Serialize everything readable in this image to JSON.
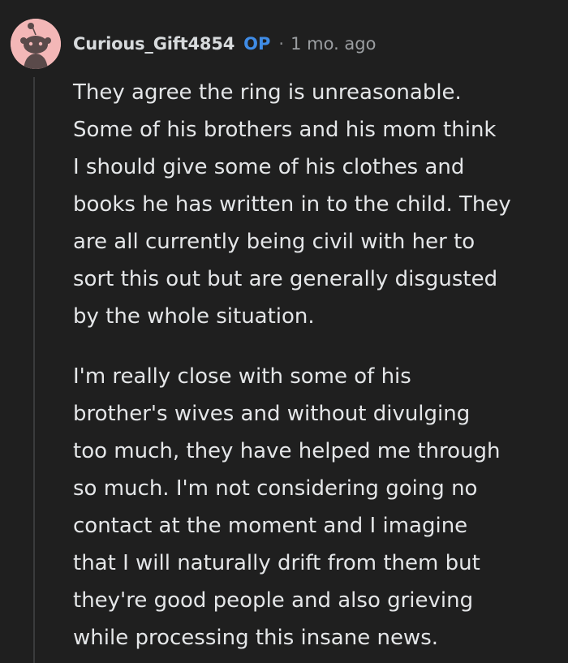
{
  "comment": {
    "username": "Curious_Gift4854",
    "op_badge": "OP",
    "separator": "·",
    "timestamp": "1 mo. ago",
    "avatar_icon": "snoo-avatar-icon",
    "paragraphs": [
      [
        "They agree the ring is unreasonable.",
        "Some of his brothers and his mom think",
        "I should give some of his clothes and",
        "books he has written in to the child. They",
        "are all currently being civil with her to",
        "sort this out but are generally disgusted",
        "by the whole situation."
      ],
      [
        "I'm really close with some of his",
        "brother's wives and without divulging",
        "too much, they have helped me through",
        "so much. I'm not considering going no",
        "contact at the moment and I imagine",
        "that I will naturally drift from them but",
        "they're good people and also grieving",
        "while processing this insane news."
      ]
    ]
  },
  "colors": {
    "background": "#1f1f1f",
    "text": "#e4e6e8",
    "op_badge": "#3f8ce6",
    "meta": "#9b9ea1",
    "avatar_bg": "#f3b7b7"
  }
}
